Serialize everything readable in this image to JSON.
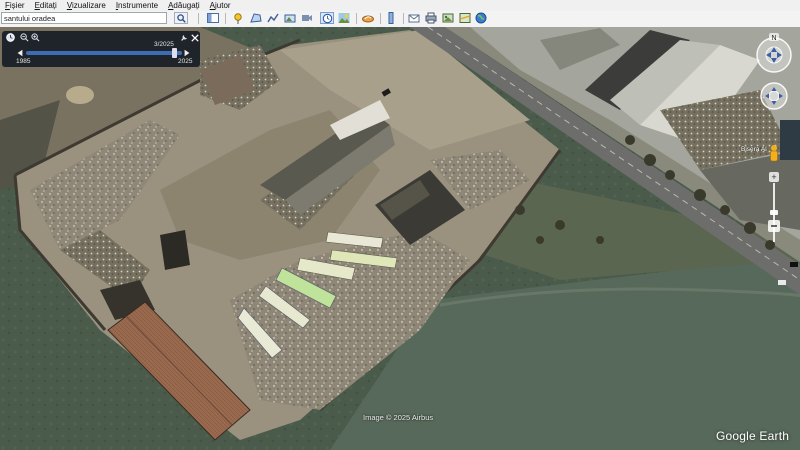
{
  "menu": {
    "items": [
      {
        "accel": "F",
        "rest": "ișier"
      },
      {
        "accel": "E",
        "rest": "ditați"
      },
      {
        "accel": "V",
        "rest": "izualizare"
      },
      {
        "accel": "I",
        "rest": "nstrumente"
      },
      {
        "accel": "A",
        "rest": "dăugați"
      },
      {
        "accel": "A",
        "rest": "jutor"
      }
    ]
  },
  "search": {
    "value": "santului oradea"
  },
  "timeslider": {
    "date": "3/2025",
    "start_year": "1985",
    "end_year": "2025",
    "position": 0.95
  },
  "map": {
    "attribution": "Image © 2025 Airbus",
    "brand": "Google Earth",
    "place_label": "Bisera Al"
  },
  "colors": {
    "accent": "#3d6db5",
    "slider_bg": "#0a141e"
  }
}
